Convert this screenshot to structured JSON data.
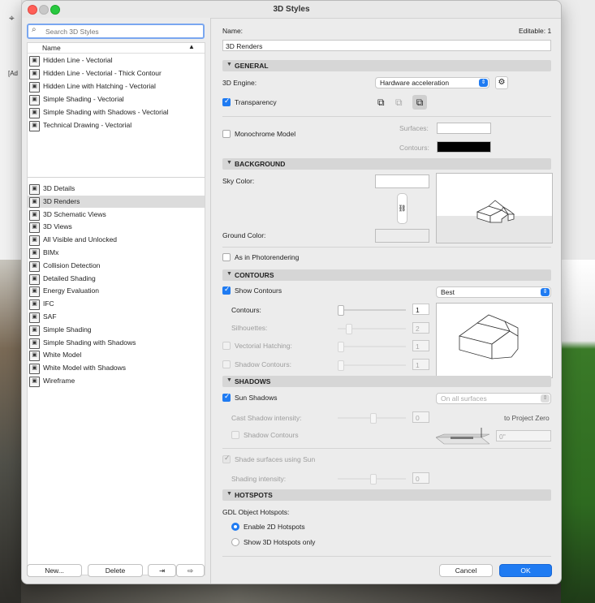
{
  "window": {
    "title": "3D Styles"
  },
  "background_app": {
    "cut_label": "[Ad"
  },
  "sidebar": {
    "search_placeholder": "Search 3D Styles",
    "column_header": "Name",
    "group1": [
      "Hidden Line - Vectorial",
      "Hidden Line - Vectorial - Thick Contour",
      "Hidden Line with Hatching - Vectorial",
      "Simple Shading - Vectorial",
      "Simple Shading with Shadows - Vectorial",
      "Technical Drawing - Vectorial"
    ],
    "group2": [
      "3D Details",
      "3D Renders",
      "3D Schematic Views",
      "3D Views",
      "All Visible and Unlocked",
      "BIMx",
      "Collision Detection",
      "Detailed Shading",
      "Energy Evaluation",
      "IFC",
      "SAF",
      "Simple Shading",
      "Simple Shading with Shadows",
      "White Model",
      "White Model with Shadows",
      "Wireframe"
    ],
    "selected": "3D Renders",
    "new_button": "New...",
    "delete_button": "Delete"
  },
  "header": {
    "name_label": "Name:",
    "editable": "Editable: 1",
    "name_value": "3D Renders"
  },
  "general": {
    "title": "GENERAL",
    "engine_label": "3D Engine:",
    "engine_value": "Hardware acceleration",
    "transparency_label": "Transparency",
    "transparency_checked": true,
    "monochrome_label": "Monochrome Model",
    "surfaces_label": "Surfaces:",
    "contours_label": "Contours:",
    "surfaces_color": "#ffffff",
    "contours_color": "#000000"
  },
  "background": {
    "title": "BACKGROUND",
    "sky_label": "Sky Color:",
    "ground_label": "Ground Color:",
    "photorender_label": "As in Photorendering",
    "sky_color": "#ffffff",
    "ground_color": "#ececec"
  },
  "contours": {
    "title": "CONTOURS",
    "show_label": "Show Contours",
    "quality": "Best",
    "contours_label": "Contours:",
    "contours_value": "1",
    "silhouettes_label": "Silhouettes:",
    "silhouettes_value": "2",
    "vect_hatching_label": "Vectorial Hatching:",
    "vect_hatching_value": "1",
    "shadow_contours_label": "Shadow Contours:",
    "shadow_contours_value": "1"
  },
  "shadows": {
    "title": "SHADOWS",
    "sun_label": "Sun Shadows",
    "surfaces_option": "On all surfaces",
    "cast_label": "Cast Shadow intensity:",
    "cast_value": "0",
    "project_zero": "to Project Zero",
    "shadow_contours_label": "Shadow Contours",
    "angle_value": "0\"",
    "shade_label": "Shade surfaces using Sun",
    "shading_label": "Shading intensity:",
    "shading_value": "0"
  },
  "hotspots": {
    "title": "HOTSPOTS",
    "gdl_label": "GDL Object Hotspots:",
    "opt1": "Enable 2D Hotspots",
    "opt2": "Show 3D Hotspots only"
  },
  "footer": {
    "cancel": "Cancel",
    "ok": "OK"
  },
  "accent": "#1f7bf2"
}
